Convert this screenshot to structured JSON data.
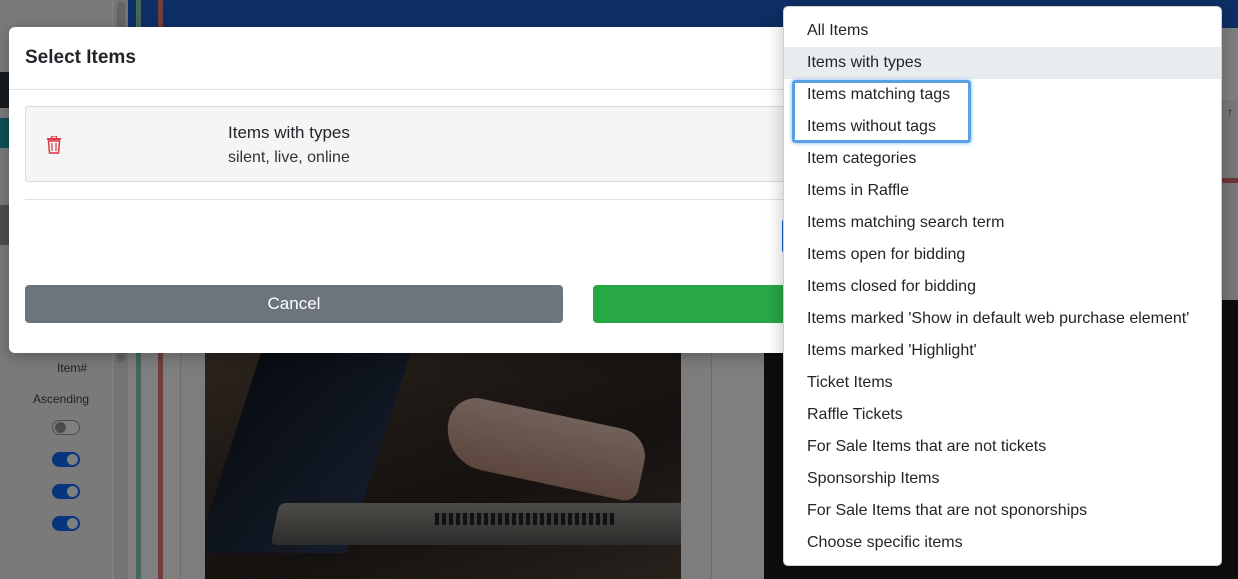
{
  "background": {
    "left_labels": [
      "Item#",
      "Ascending"
    ],
    "toggles": [
      false,
      true,
      true,
      true
    ]
  },
  "modal": {
    "title": "Select Items",
    "rule": {
      "title": "Items with types",
      "subtitle": "silent, live, online"
    },
    "cancel_label": "Cancel"
  },
  "dropdown": {
    "selected_index": 1,
    "highlighted_indices": [
      2,
      3
    ],
    "items": [
      "All Items",
      "Items with types",
      "Items matching tags",
      "Items without tags",
      "Item categories",
      "Items in Raffle",
      "Items matching search term",
      "Items open for bidding",
      "Items closed for bidding",
      "Items marked 'Show in default web purchase element'",
      "Items marked 'Highlight'",
      "Ticket Items",
      "Raffle Tickets",
      "For Sale Items that are not tickets",
      "Sponsorship Items",
      "For Sale Items that are not sponorships",
      "Choose specific items"
    ]
  },
  "colors": {
    "primary": "#1a5ec8",
    "success": "#28a745",
    "secondary": "#6c757d",
    "danger": "#dc3545",
    "focus_ring": "#5aa0e6"
  },
  "icons": {
    "delete": "trash-icon"
  }
}
